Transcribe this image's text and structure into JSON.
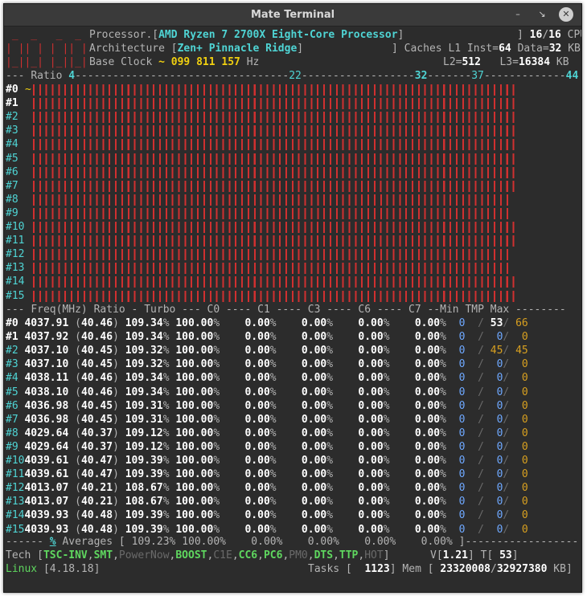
{
  "window": {
    "title": "Mate Terminal",
    "minimize_glyph": "–",
    "maximize_glyph": "↘",
    "close_glyph": "✕"
  },
  "header": {
    "logo_lines": [
      " _  _   _  _",
      "| || | | || |",
      "|_||_| |_||_|"
    ],
    "processor_label": "Processor",
    "processor_value": "AMD Ryzen 7 2700X Eight-Core Processor",
    "cpu_online": "16",
    "cpu_total": "16",
    "cpu_label": "CPU",
    "architecture_label": "Architecture",
    "architecture_value": "Zen+ Pinnacle Ridge",
    "caches_label": "Caches",
    "l1_inst_label": "L1 Inst",
    "l1_inst_value": "64",
    "l1_data_label": "Data",
    "l1_data_value": "32",
    "kb_label": "KB",
    "base_clock_label": "Base Clock",
    "base_clock_value": "~ 099 811 157",
    "hz_label": "Hz",
    "l2_label": "L2",
    "l2_value": "512",
    "l3_label": "L3",
    "l3_value": "16384"
  },
  "ratio_ruler": {
    "label": "Ratio",
    "marks": [
      "4",
      "22",
      "32",
      "37",
      "44"
    ]
  },
  "cores": [
    {
      "id": "#0",
      "fill": 0.862,
      "freq": "4037.91",
      "ratio": "40.46",
      "turbo": "109.34",
      "c0": "100.00",
      "c1": "0.00",
      "c3": "0.00",
      "c6": "0.00",
      "c7": "0.00",
      "tmin": "0",
      "tcur": "53",
      "tmax": "66"
    },
    {
      "id": "#1",
      "fill": 0.862,
      "freq": "4037.92",
      "ratio": "40.46",
      "turbo": "109.34",
      "c0": "100.00",
      "c1": "0.00",
      "c3": "0.00",
      "c6": "0.00",
      "c7": "0.00",
      "tmin": "0",
      "tcur": "0",
      "tmax": "0"
    },
    {
      "id": "#2",
      "fill": 0.862,
      "freq": "4037.10",
      "ratio": "40.45",
      "turbo": "109.32",
      "c0": "100.00",
      "c1": "0.00",
      "c3": "0.00",
      "c6": "0.00",
      "c7": "0.00",
      "tmin": "0",
      "tcur": "45",
      "tmax": "45"
    },
    {
      "id": "#3",
      "fill": 0.862,
      "freq": "4037.10",
      "ratio": "40.45",
      "turbo": "109.32",
      "c0": "100.00",
      "c1": "0.00",
      "c3": "0.00",
      "c6": "0.00",
      "c7": "0.00",
      "tmin": "0",
      "tcur": "0",
      "tmax": "0"
    },
    {
      "id": "#4",
      "fill": 0.862,
      "freq": "4038.11",
      "ratio": "40.46",
      "turbo": "109.34",
      "c0": "100.00",
      "c1": "0.00",
      "c3": "0.00",
      "c6": "0.00",
      "c7": "0.00",
      "tmin": "0",
      "tcur": "0",
      "tmax": "0"
    },
    {
      "id": "#5",
      "fill": 0.862,
      "freq": "4038.10",
      "ratio": "40.46",
      "turbo": "109.34",
      "c0": "100.00",
      "c1": "0.00",
      "c3": "0.00",
      "c6": "0.00",
      "c7": "0.00",
      "tmin": "0",
      "tcur": "0",
      "tmax": "0"
    },
    {
      "id": "#6",
      "fill": 0.862,
      "freq": "4036.98",
      "ratio": "40.45",
      "turbo": "109.31",
      "c0": "100.00",
      "c1": "0.00",
      "c3": "0.00",
      "c6": "0.00",
      "c7": "0.00",
      "tmin": "0",
      "tcur": "0",
      "tmax": "0"
    },
    {
      "id": "#7",
      "fill": 0.862,
      "freq": "4036.98",
      "ratio": "40.45",
      "turbo": "109.31",
      "c0": "100.00",
      "c1": "0.00",
      "c3": "0.00",
      "c6": "0.00",
      "c7": "0.00",
      "tmin": "0",
      "tcur": "0",
      "tmax": "0"
    },
    {
      "id": "#8",
      "fill": 0.845,
      "freq": "4029.64",
      "ratio": "40.37",
      "turbo": "109.12",
      "c0": "100.00",
      "c1": "0.00",
      "c3": "0.00",
      "c6": "0.00",
      "c7": "0.00",
      "tmin": "0",
      "tcur": "0",
      "tmax": "0"
    },
    {
      "id": "#9",
      "fill": 0.845,
      "freq": "4029.64",
      "ratio": "40.37",
      "turbo": "109.12",
      "c0": "100.00",
      "c1": "0.00",
      "c3": "0.00",
      "c6": "0.00",
      "c7": "0.00",
      "tmin": "0",
      "tcur": "0",
      "tmax": "0"
    },
    {
      "id": "#10",
      "fill": 0.862,
      "freq": "4039.61",
      "ratio": "40.47",
      "turbo": "109.39",
      "c0": "100.00",
      "c1": "0.00",
      "c3": "0.00",
      "c6": "0.00",
      "c7": "0.00",
      "tmin": "0",
      "tcur": "0",
      "tmax": "0"
    },
    {
      "id": "#11",
      "fill": 0.862,
      "freq": "4039.61",
      "ratio": "40.47",
      "turbo": "109.39",
      "c0": "100.00",
      "c1": "0.00",
      "c3": "0.00",
      "c6": "0.00",
      "c7": "0.00",
      "tmin": "0",
      "tcur": "0",
      "tmax": "0"
    },
    {
      "id": "#12",
      "fill": 0.845,
      "freq": "4013.07",
      "ratio": "40.21",
      "turbo": "108.67",
      "c0": "100.00",
      "c1": "0.00",
      "c3": "0.00",
      "c6": "0.00",
      "c7": "0.00",
      "tmin": "0",
      "tcur": "0",
      "tmax": "0"
    },
    {
      "id": "#13",
      "fill": 0.845,
      "freq": "4013.07",
      "ratio": "40.21",
      "turbo": "108.67",
      "c0": "100.00",
      "c1": "0.00",
      "c3": "0.00",
      "c6": "0.00",
      "c7": "0.00",
      "tmin": "0",
      "tcur": "0",
      "tmax": "0"
    },
    {
      "id": "#14",
      "fill": 0.862,
      "freq": "4039.93",
      "ratio": "40.48",
      "turbo": "109.39",
      "c0": "100.00",
      "c1": "0.00",
      "c3": "0.00",
      "c6": "0.00",
      "c7": "0.00",
      "tmin": "0",
      "tcur": "0",
      "tmax": "0"
    },
    {
      "id": "#15",
      "fill": 0.862,
      "freq": "4039.93",
      "ratio": "40.48",
      "turbo": "109.39",
      "c0": "100.00",
      "c1": "0.00",
      "c3": "0.00",
      "c6": "0.00",
      "c7": "0.00",
      "tmin": "0",
      "tcur": "0",
      "tmax": "0"
    }
  ],
  "table_header": {
    "freq": "Freq(MHz)",
    "ratio": "Ratio",
    "turbo": "Turbo",
    "c0": "C0",
    "c1": "C1",
    "c3": "C3",
    "c6": "C6",
    "c7": "C7",
    "temp": "Min TMP Max"
  },
  "averages": {
    "percent_symbol": "%",
    "label": "Averages",
    "turbo": "109.23",
    "c0": "100.00",
    "c1": "0.00",
    "c3": "0.00",
    "c6": "0.00",
    "c7": "0.00"
  },
  "tech": {
    "label": "Tech",
    "features": [
      {
        "name": "TSC-INV",
        "active": true
      },
      {
        "name": "SMT",
        "active": true
      },
      {
        "name": "PowerNow",
        "active": false
      },
      {
        "name": "BOOST",
        "active": true
      },
      {
        "name": "C1E",
        "active": false
      },
      {
        "name": "CC6",
        "active": true
      },
      {
        "name": "PC6",
        "active": true
      },
      {
        "name": "PM0",
        "active": false
      },
      {
        "name": "DTS",
        "active": true
      },
      {
        "name": "TTP",
        "active": true
      },
      {
        "name": "HOT",
        "active": false
      }
    ],
    "voltage_label": "V",
    "voltage_value": "1.21",
    "temp_label": "T",
    "temp_value": "53"
  },
  "status": {
    "os_label": "Linux",
    "kernel": "4.18.18",
    "tasks_label": "Tasks",
    "tasks_value": "1123",
    "mem_label": "Mem",
    "mem_used": "23320008",
    "mem_total": "32927380",
    "mem_unit": "KB"
  },
  "colors": {
    "background": "#2c2c2c",
    "bar": "#d03030",
    "cyan": "#4fd4d4",
    "yellow": "#f0d010",
    "green": "#5fd75f",
    "temperature": "#d8a020",
    "min_temp": "#6ea8ff"
  }
}
